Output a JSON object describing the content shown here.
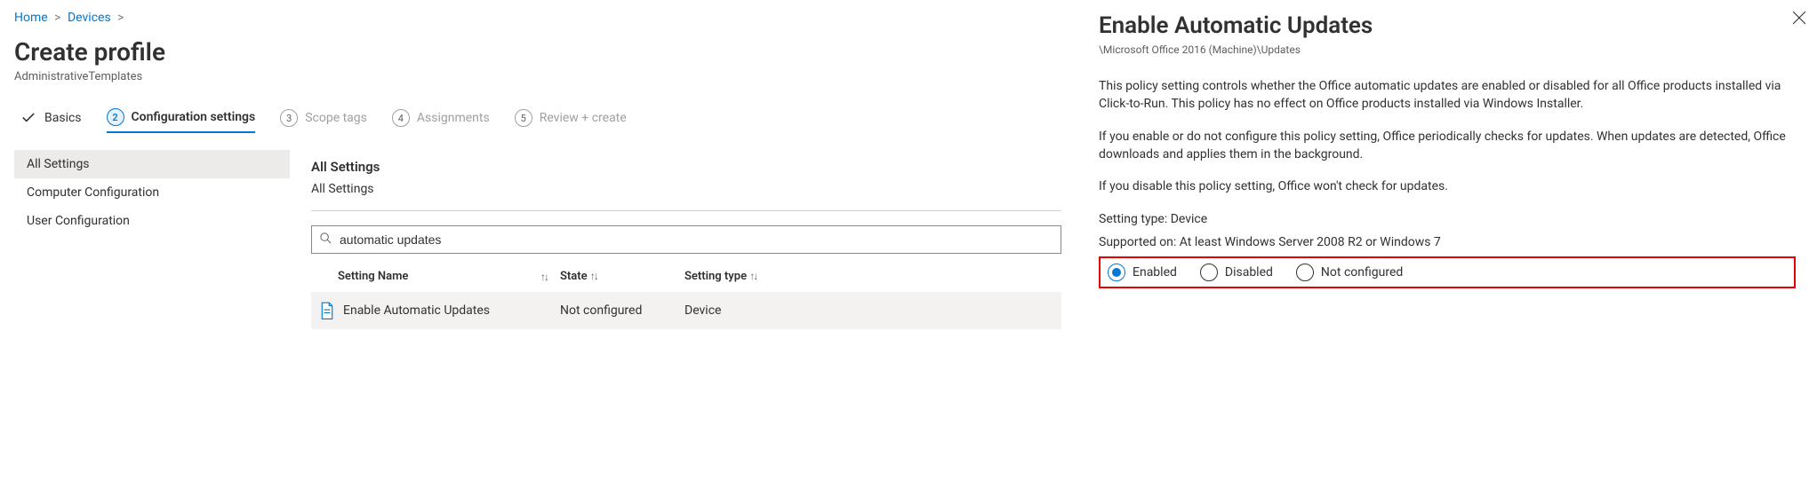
{
  "breadcrumb": {
    "home": "Home",
    "devices": "Devices"
  },
  "page": {
    "title": "Create profile",
    "subtitle": "AdministrativeTemplates"
  },
  "steps": {
    "basics": "Basics",
    "config_num": "2",
    "config": "Configuration settings",
    "scope_num": "3",
    "scope": "Scope tags",
    "assign_num": "4",
    "assign": "Assignments",
    "review_num": "5",
    "review": "Review + create"
  },
  "tree": {
    "all": "All Settings",
    "computer": "Computer Configuration",
    "user": "User Configuration"
  },
  "settings": {
    "heading": "All Settings",
    "path": "All Settings",
    "search_value": "automatic updates",
    "columns": {
      "name": "Setting Name",
      "state": "State",
      "type": "Setting type"
    },
    "row": {
      "name": "Enable Automatic Updates",
      "state": "Not configured",
      "type": "Device"
    }
  },
  "flyout": {
    "title": "Enable Automatic Updates",
    "path": "\\Microsoft Office 2016 (Machine)\\Updates",
    "p1": "This policy setting controls whether the Office automatic updates are enabled or disabled for all Office products installed via Click-to-Run. This policy has no effect on Office products installed via Windows Installer.",
    "p2": "If you enable or do not configure this policy setting, Office periodically checks for updates. When updates are detected, Office downloads and applies them in the background.",
    "p3": "If you disable this policy setting, Office won't check for updates.",
    "setting_type": "Setting type: Device",
    "supported": "Supported on: At least Windows Server 2008 R2 or Windows 7",
    "radios": {
      "enabled": "Enabled",
      "disabled": "Disabled",
      "not_configured": "Not configured"
    }
  }
}
